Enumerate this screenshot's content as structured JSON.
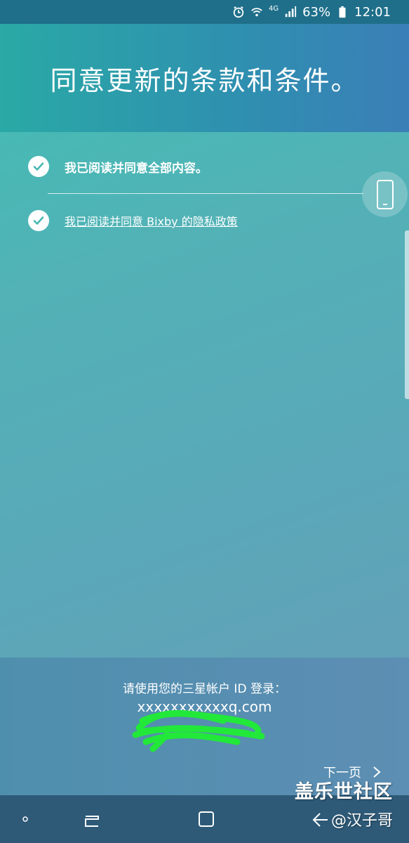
{
  "status_bar": {
    "network": "4G",
    "battery": "63%",
    "time": "12:01",
    "icons": [
      "alarm-icon",
      "wifi-icon",
      "signal-icon",
      "battery-icon"
    ]
  },
  "header": {
    "title": "同意更新的条款和条件。"
  },
  "agreements": [
    {
      "label": "我已阅读并同意全部内容。",
      "checked": true
    },
    {
      "label": "我已阅读并同意 Bixby 的隐私政策",
      "checked": true
    }
  ],
  "login": {
    "label": "请使用您的三星帐户 ID 登录：",
    "account_id": "xxxxxxxxxxxq.com"
  },
  "footer": {
    "next_label": "下一页"
  },
  "watermark": {
    "line1": "盖乐世社区",
    "line2": "@汉子哥"
  },
  "nav": {
    "items": [
      "recent-apps",
      "home",
      "back"
    ]
  },
  "colors": {
    "accent": "#3fbfb4",
    "header": "#2f8fb0",
    "nav": "#2e5a78"
  }
}
